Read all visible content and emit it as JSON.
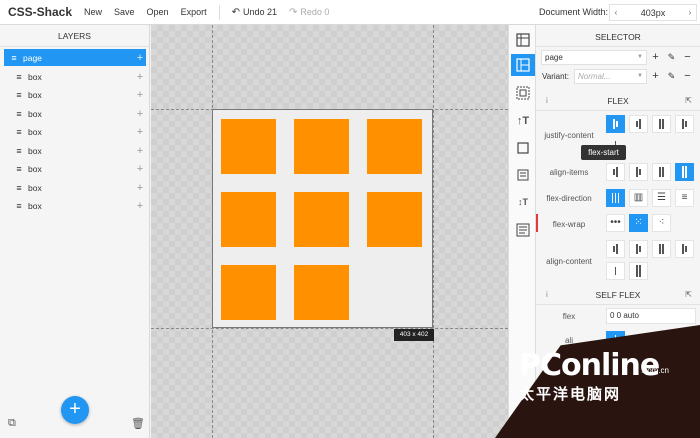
{
  "toolbar": {
    "app_title": "CSS-Shack",
    "new_label": "New",
    "save_label": "Save",
    "open_label": "Open",
    "export_label": "Export",
    "undo_label": "Undo 21",
    "redo_label": "Redo 0",
    "doc_width_label": "Document Width:",
    "doc_width_value": "403px"
  },
  "layers": {
    "title": "LAYERS",
    "items": [
      {
        "label": "page",
        "selected": true
      },
      {
        "label": "box"
      },
      {
        "label": "box"
      },
      {
        "label": "box"
      },
      {
        "label": "box"
      },
      {
        "label": "box"
      },
      {
        "label": "box"
      },
      {
        "label": "box"
      },
      {
        "label": "box"
      }
    ]
  },
  "canvas": {
    "size_tag": "403 x 402",
    "box_color": "#ff9000"
  },
  "tool_icons": [
    "grid-layout-icon",
    "flex-layout-icon",
    "box-model-icon",
    "typography-icon",
    "border-icon",
    "background-icon",
    "text-style-icon",
    "code-icon"
  ],
  "selector": {
    "title": "SELECTOR",
    "selector_value": "page",
    "variant_label": "Variant:",
    "variant_placeholder": "Normal..."
  },
  "flex": {
    "title": "FLEX",
    "justify_content_label": "justify-content",
    "align_items_label": "align-items",
    "flex_direction_label": "flex-direction",
    "flex_wrap_label": "flex-wrap",
    "align_content_label": "align-content",
    "tooltip": "flex-start"
  },
  "self_flex": {
    "title": "SELF FLEX",
    "flex_label": "flex",
    "flex_value": "0 0 auto",
    "align_label": "ali"
  },
  "watermark": {
    "brand": "PConline",
    "domain": ".com.cn",
    "sub": "太平洋电脑网"
  },
  "colors": {
    "accent": "#2196f3",
    "box": "#ff9000"
  }
}
